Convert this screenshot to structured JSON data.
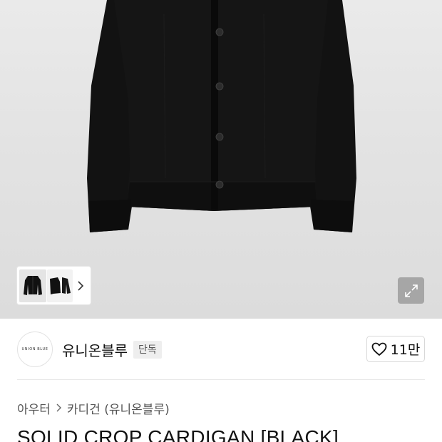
{
  "brand": {
    "logo_text": "UNION BLUE",
    "name": "유니온블루",
    "badge": "단독"
  },
  "like": {
    "icon": "heart-icon",
    "count": "11만"
  },
  "gallery": {
    "thumbnail_count_visible": 2,
    "next_icon": "chevron-right-icon",
    "expand_icon": "expand-icon"
  },
  "breadcrumb": {
    "items": [
      "아우터",
      "카디건 (유니온블루)"
    ],
    "separator_icon": "chevron-right-icon"
  },
  "product": {
    "title": "SOLID CROP CARDIGAN [BLACK]"
  },
  "colors": {
    "image_background": "#e3e3e3",
    "garment": "#111111",
    "badge_bg": "#eeeeee"
  }
}
